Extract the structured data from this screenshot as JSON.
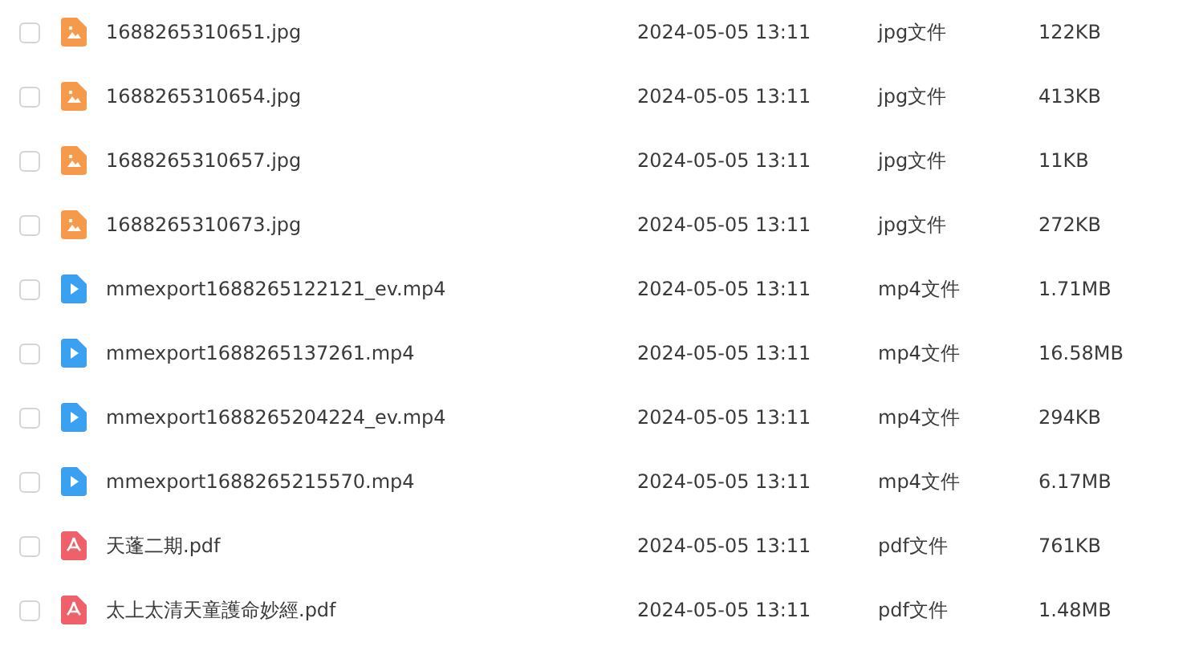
{
  "files": [
    {
      "kind": "image",
      "name": "1688265310651.jpg",
      "date": "2024-05-05 13:11",
      "type": "jpg文件",
      "size": "122KB",
      "checked": false
    },
    {
      "kind": "image",
      "name": "1688265310654.jpg",
      "date": "2024-05-05 13:11",
      "type": "jpg文件",
      "size": "413KB",
      "checked": false
    },
    {
      "kind": "image",
      "name": "1688265310657.jpg",
      "date": "2024-05-05 13:11",
      "type": "jpg文件",
      "size": "11KB",
      "checked": false
    },
    {
      "kind": "image",
      "name": "1688265310673.jpg",
      "date": "2024-05-05 13:11",
      "type": "jpg文件",
      "size": "272KB",
      "checked": false
    },
    {
      "kind": "video",
      "name": "mmexport1688265122121_ev.mp4",
      "date": "2024-05-05 13:11",
      "type": "mp4文件",
      "size": "1.71MB",
      "checked": false
    },
    {
      "kind": "video",
      "name": "mmexport1688265137261.mp4",
      "date": "2024-05-05 13:11",
      "type": "mp4文件",
      "size": "16.58MB",
      "checked": false
    },
    {
      "kind": "video",
      "name": "mmexport1688265204224_ev.mp4",
      "date": "2024-05-05 13:11",
      "type": "mp4文件",
      "size": "294KB",
      "checked": false
    },
    {
      "kind": "video",
      "name": "mmexport1688265215570.mp4",
      "date": "2024-05-05 13:11",
      "type": "mp4文件",
      "size": "6.17MB",
      "checked": false
    },
    {
      "kind": "pdf",
      "name": "天蓬二期.pdf",
      "date": "2024-05-05 13:11",
      "type": "pdf文件",
      "size": "761KB",
      "checked": false
    },
    {
      "kind": "pdf",
      "name": "太上太清天童護命妙經.pdf",
      "date": "2024-05-05 13:11",
      "type": "pdf文件",
      "size": "1.48MB",
      "checked": false
    }
  ]
}
